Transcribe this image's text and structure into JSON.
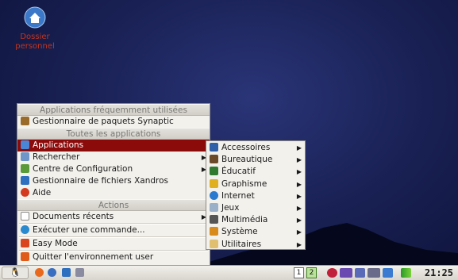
{
  "desktop": {
    "icon_label_line1": "Dossier",
    "icon_label_line2": "personnel"
  },
  "menu": {
    "header_frequent": "Applications fréquemment utilisées",
    "frequent_items": [
      {
        "label": "Gestionnaire de paquets Synaptic"
      }
    ],
    "header_all": "Toutes les applications",
    "all_items": [
      {
        "label": "Applications"
      },
      {
        "label": "Rechercher"
      },
      {
        "label": "Centre de Configuration"
      },
      {
        "label": "Gestionnaire de fichiers Xandros"
      },
      {
        "label": "Aide"
      }
    ],
    "header_actions": "Actions",
    "action_items": [
      {
        "label": "Documents récents"
      },
      {
        "label": "Exécuter une commande..."
      },
      {
        "label": "Easy Mode"
      },
      {
        "label": "Quitter l'environnement user"
      }
    ]
  },
  "submenu": {
    "items": [
      {
        "label": "Accessoires"
      },
      {
        "label": "Bureautique"
      },
      {
        "label": "Éducatif"
      },
      {
        "label": "Graphisme"
      },
      {
        "label": "Internet"
      },
      {
        "label": "Jeux"
      },
      {
        "label": "Multimédia"
      },
      {
        "label": "Système"
      },
      {
        "label": "Utilitaires"
      }
    ]
  },
  "taskbar": {
    "workspace_1": "1",
    "workspace_2": "2",
    "clock": "21:25"
  },
  "colors": {
    "selection": "#8b0a0a",
    "desktop": "#1a2256"
  }
}
